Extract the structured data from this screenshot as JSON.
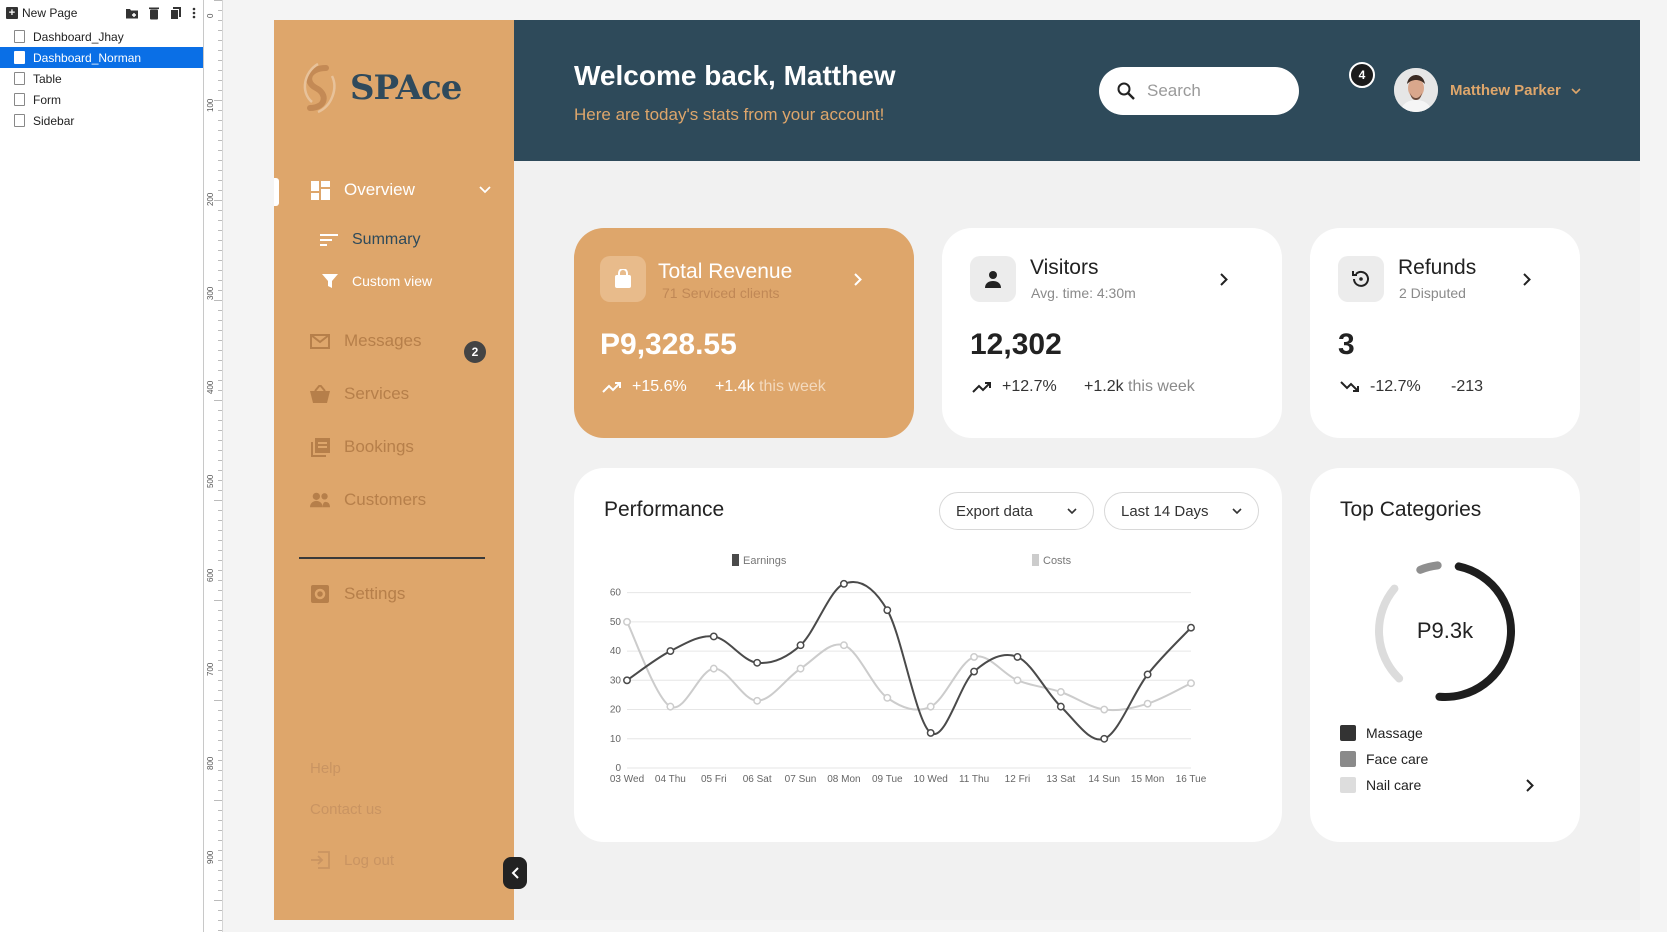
{
  "editor": {
    "new_page_label": "New Page",
    "pages": [
      "Dashboard_Jhay",
      "Dashboard_Norman",
      "Table",
      "Form",
      "Sidebar"
    ],
    "active_page": "Dashboard_Norman",
    "ruler_marks": [
      "0",
      "100",
      "200",
      "300",
      "400",
      "500",
      "600",
      "700",
      "800",
      "900"
    ]
  },
  "brand": {
    "name": "SPAce",
    "primary": "#dea66b",
    "dark": "#2e4a5a"
  },
  "header": {
    "welcome": "Welcome back, Matthew",
    "subtitle": "Here are today's stats from your account!",
    "search_placeholder": "Search",
    "notification_count": "4",
    "user_name": "Matthew Parker"
  },
  "sidebar": {
    "overview": "Overview",
    "summary": "Summary",
    "custom_view": "Custom view",
    "messages": "Messages",
    "messages_badge": "2",
    "services": "Services",
    "bookings": "Bookings",
    "customers": "Customers",
    "settings": "Settings",
    "help": "Help",
    "contact": "Contact us",
    "logout": "Log out"
  },
  "cards": {
    "revenue": {
      "title": "Total Revenue",
      "sub": "71 Serviced clients",
      "value": "P9,328.55",
      "change": "+15.6%",
      "week_value": "+1.4k",
      "week_label": "this week"
    },
    "visitors": {
      "title": "Visitors",
      "sub": "Avg. time: 4:30m",
      "value": "12,302",
      "change": "+12.7%",
      "week_value": "+1.2k",
      "week_label": "this week"
    },
    "refunds": {
      "title": "Refunds",
      "sub": "2 Disputed",
      "value": "3",
      "change": "-12.7%",
      "week_value": "-213"
    }
  },
  "performance": {
    "title": "Performance",
    "export_label": "Export data",
    "range_label": "Last 14 Days"
  },
  "chart_data": {
    "type": "line",
    "x": [
      "03 Wed",
      "04 Thu",
      "05 Fri",
      "06 Sat",
      "07 Sun",
      "08 Mon",
      "09 Tue",
      "10 Wed",
      "11 Thu",
      "12 Fri",
      "13 Sat",
      "14 Sun",
      "15 Mon",
      "16 Tue"
    ],
    "series": [
      {
        "name": "Earnings",
        "color": "#4a4a4a",
        "values": [
          30,
          40,
          45,
          36,
          42,
          63,
          54,
          12,
          33,
          38,
          21,
          10,
          32,
          48
        ]
      },
      {
        "name": "Costs",
        "color": "#cccccc",
        "values": [
          50,
          21,
          34,
          23,
          34,
          42,
          24,
          21,
          38,
          30,
          26,
          20,
          22,
          29
        ]
      }
    ],
    "yticks": [
      0,
      10,
      20,
      30,
      40,
      50,
      60
    ],
    "ylim": [
      0,
      65
    ],
    "grid": true,
    "legend_position": "top"
  },
  "categories": {
    "title": "Top Categories",
    "total": "P9.3k",
    "items": [
      {
        "label": "Massage",
        "color": "#333333"
      },
      {
        "label": "Face care",
        "color": "#8a8a8a"
      },
      {
        "label": "Nail care",
        "color": "#dddddd"
      }
    ]
  }
}
